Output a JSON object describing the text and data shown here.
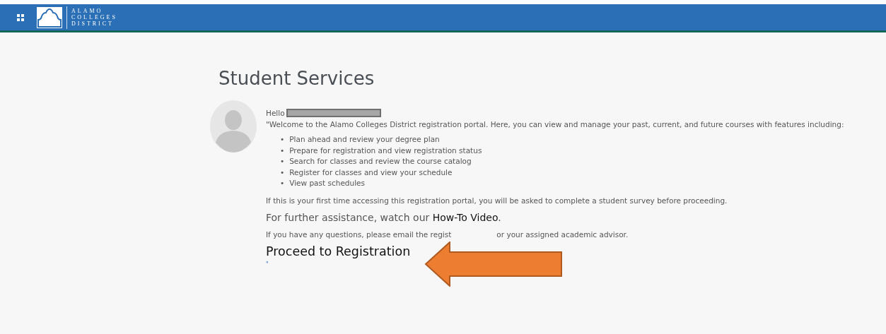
{
  "header": {
    "logo_lines": [
      "ALAMO",
      "COLLEGES",
      "DISTRICT"
    ]
  },
  "page_title": "Student Services",
  "greeting": "Hello",
  "welcome": "\"Welcome to the Alamo Colleges District registration portal. Here, you can view and manage your past, current, and future courses with features including:",
  "bullet": "•",
  "features": [
    "Plan ahead and review your degree plan",
    "Prepare for registration and view registration status",
    "Search for classes and review the course catalog",
    "Register for classes and view your schedule",
    "View past schedules"
  ],
  "survey_note": "If this is your first time accessing this registration portal, you will be asked to complete a student survey before proceeding.",
  "assistance": {
    "text": "For further assistance, watch our ",
    "link": "How-To Video",
    "end": "."
  },
  "questions_note": [
    "If you have any questions, please email the regist",
    "or your assigned academic advisor."
  ],
  "proceed_link": "Proceed to Registration",
  "closing_quote": "\""
}
